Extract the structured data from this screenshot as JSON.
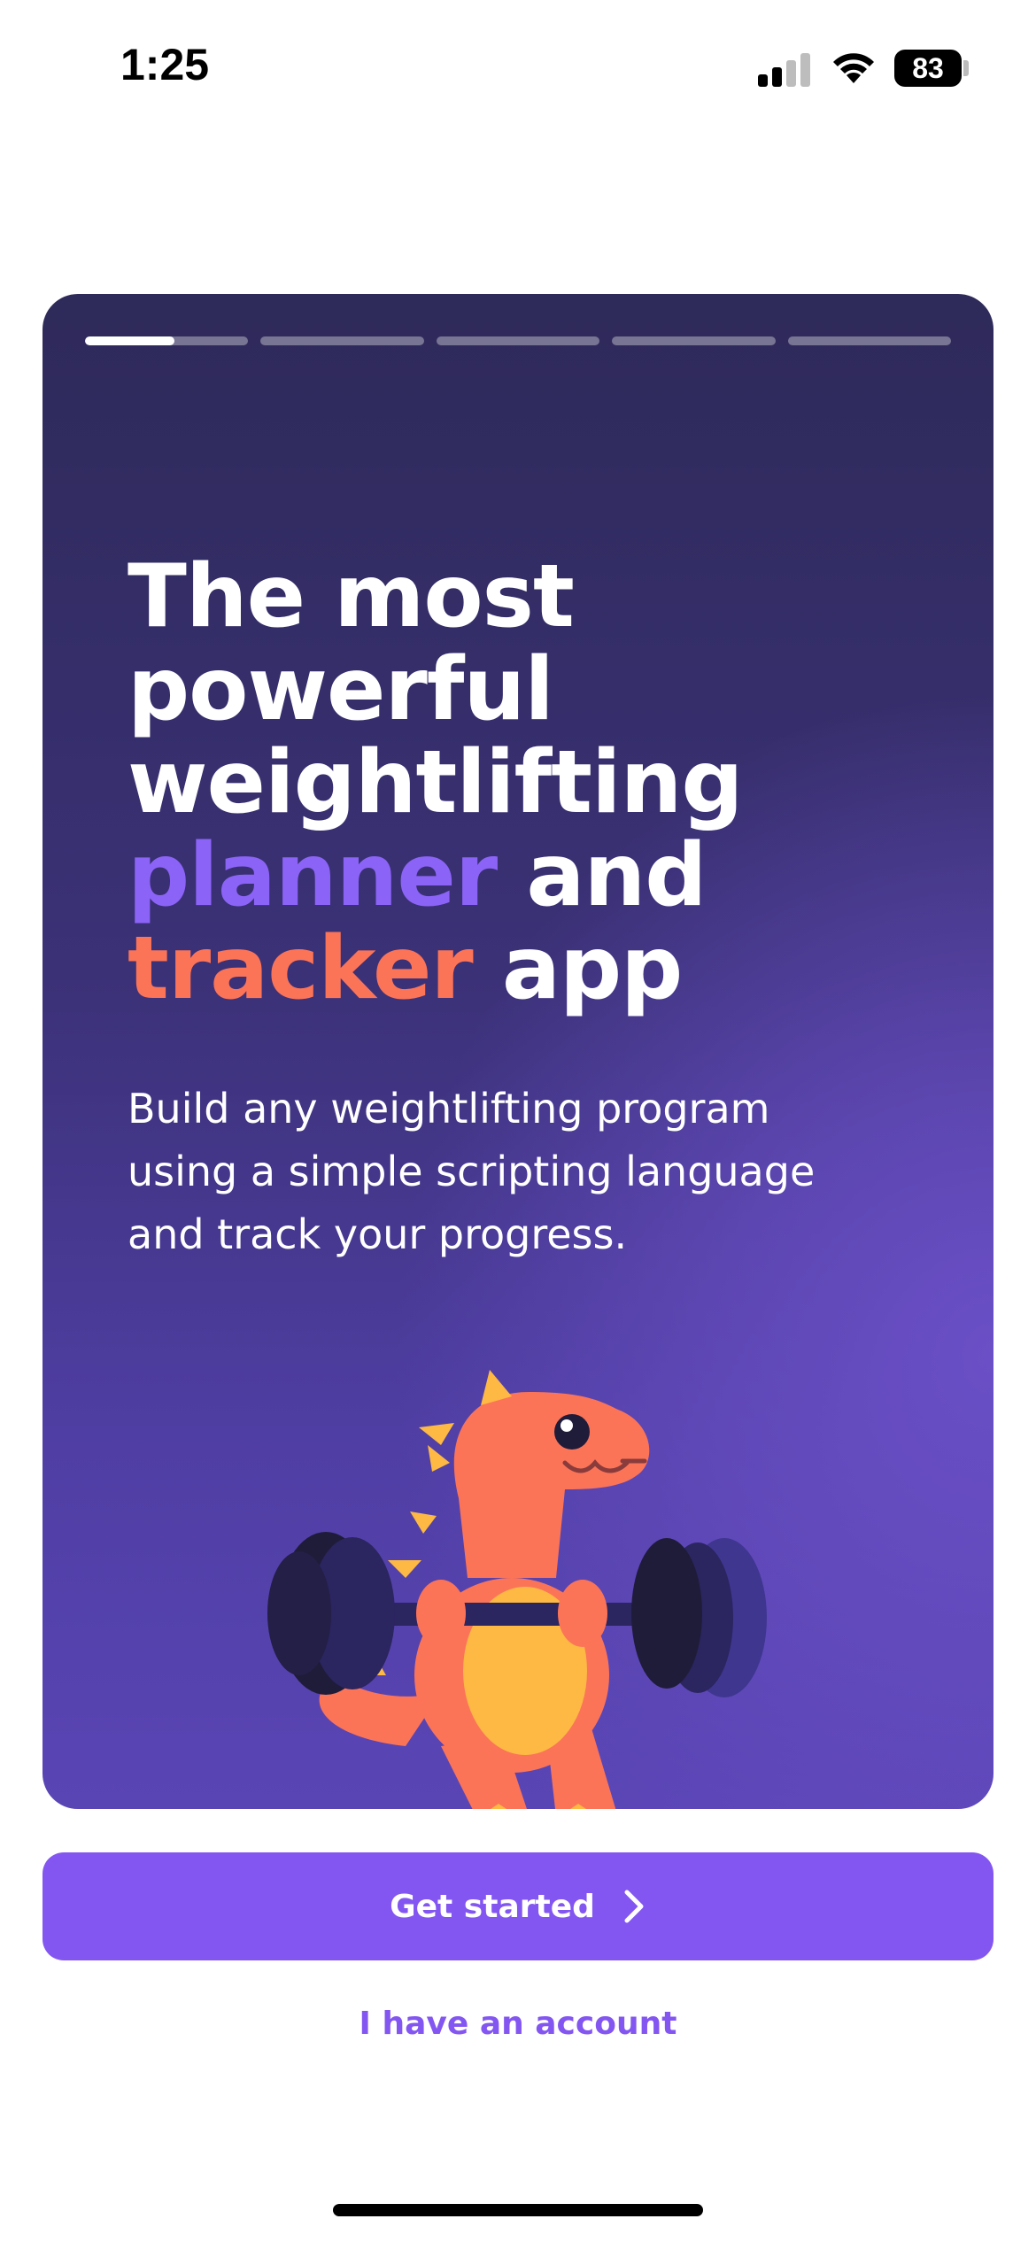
{
  "status_bar": {
    "time": "1:25",
    "battery": "83",
    "icons": [
      "cellular-signal-icon",
      "wifi-icon",
      "battery-icon"
    ]
  },
  "onboarding": {
    "progress": {
      "total_steps": 5,
      "current_step": 1,
      "current_step_fill": 0.55
    },
    "headline": {
      "line1": "The most",
      "line2": "powerful",
      "line3": "weightlifting",
      "line4_accent": "planner",
      "line4_rest": "and",
      "line5_accent": "tracker",
      "line5_rest": "app"
    },
    "subtext_lines": [
      "Build any weightlifting program",
      "using a simple scripting language",
      "and track your progress."
    ],
    "illustration": "dinosaur-lifting-barbell"
  },
  "actions": {
    "get_started": "Get started",
    "have_account": "I have an account"
  },
  "colors": {
    "accent_purple": "#8c63f7",
    "accent_orange": "#fb7458",
    "button": "#8356f1",
    "card_top": "#2e2a59",
    "card_bottom": "#5a45b5"
  }
}
